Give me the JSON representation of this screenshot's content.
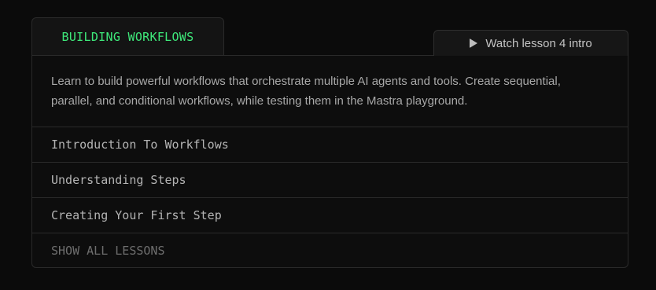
{
  "course": {
    "tab_label": "BUILDING WORKFLOWS",
    "watch_button_label": "Watch lesson 4 intro",
    "watch_button_icon": "play-icon",
    "description": "Learn to build powerful workflows that orchestrate multiple AI agents and tools. Create sequential, parallel, and conditional workflows, while testing them in the Mastra playground.",
    "lessons": [
      {
        "label": "Introduction To Workflows"
      },
      {
        "label": "Understanding Steps"
      },
      {
        "label": "Creating Your First Step"
      }
    ],
    "show_all_label": "SHOW ALL LESSONS"
  },
  "colors": {
    "accent": "#3ee87a",
    "background": "#0b0b0b",
    "border": "#2a2a2a"
  }
}
